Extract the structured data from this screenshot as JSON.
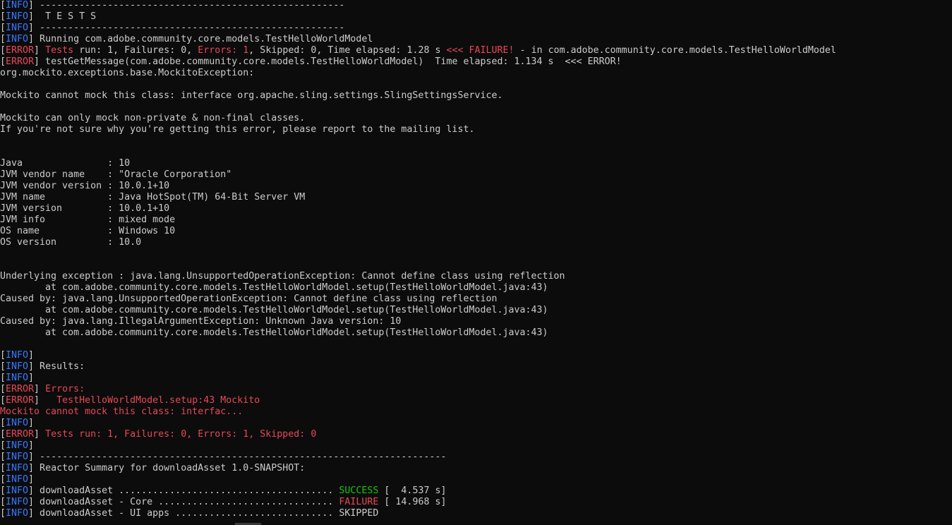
{
  "colors": {
    "background": "#0c0c0c",
    "text": "#cccccc",
    "info": "#3b78ff",
    "error": "#e74856",
    "success": "#16c60c"
  },
  "lines": [
    [
      {
        "t": "[",
        "c": "br"
      },
      {
        "t": "INFO",
        "c": "info"
      },
      {
        "t": "] ------------------------------------------------------",
        "c": "txt"
      }
    ],
    [
      {
        "t": "[",
        "c": "br"
      },
      {
        "t": "INFO",
        "c": "info"
      },
      {
        "t": "]  T E S T S",
        "c": "txt"
      }
    ],
    [
      {
        "t": "[",
        "c": "br"
      },
      {
        "t": "INFO",
        "c": "info"
      },
      {
        "t": "] ------------------------------------------------------",
        "c": "txt"
      }
    ],
    [
      {
        "t": "[",
        "c": "br"
      },
      {
        "t": "INFO",
        "c": "info"
      },
      {
        "t": "] Running com.adobe.community.core.models.TestHelloWorldModel",
        "c": "txt"
      }
    ],
    [
      {
        "t": "[",
        "c": "br"
      },
      {
        "t": "ERROR",
        "c": "err"
      },
      {
        "t": "] ",
        "c": "txt"
      },
      {
        "t": "Tests ",
        "c": "err"
      },
      {
        "t": "run: 1, Failures: 0, ",
        "c": "txt"
      },
      {
        "t": "Errors: 1",
        "c": "err"
      },
      {
        "t": ", Skipped: 0, Time elapsed: 1.28 s ",
        "c": "txt"
      },
      {
        "t": "<<< FAILURE!",
        "c": "err"
      },
      {
        "t": " - in com.adobe.community.core.models.TestHelloWorldModel",
        "c": "txt"
      }
    ],
    [
      {
        "t": "[",
        "c": "br"
      },
      {
        "t": "ERROR",
        "c": "err"
      },
      {
        "t": "] testGetMessage(com.adobe.community.core.models.TestHelloWorldModel)  Time elapsed: 1.134 s  <<< ERROR!",
        "c": "txt"
      }
    ],
    [
      {
        "t": "org.mockito.exceptions.base.MockitoException:",
        "c": "txt"
      }
    ],
    [
      {
        "t": "",
        "c": "txt"
      }
    ],
    [
      {
        "t": "Mockito cannot mock this class: interface org.apache.sling.settings.SlingSettingsService.",
        "c": "txt"
      }
    ],
    [
      {
        "t": "",
        "c": "txt"
      }
    ],
    [
      {
        "t": "Mockito can only mock non-private & non-final classes.",
        "c": "txt"
      }
    ],
    [
      {
        "t": "If you're not sure why you're getting this error, please report to the mailing list.",
        "c": "txt"
      }
    ],
    [
      {
        "t": "",
        "c": "txt"
      }
    ],
    [
      {
        "t": "",
        "c": "txt"
      }
    ],
    [
      {
        "t": "Java               : 10",
        "c": "txt"
      }
    ],
    [
      {
        "t": "JVM vendor name    : \"Oracle Corporation\"",
        "c": "txt"
      }
    ],
    [
      {
        "t": "JVM vendor version : 10.0.1+10",
        "c": "txt"
      }
    ],
    [
      {
        "t": "JVM name           : Java HotSpot(TM) 64-Bit Server VM",
        "c": "txt"
      }
    ],
    [
      {
        "t": "JVM version        : 10.0.1+10",
        "c": "txt"
      }
    ],
    [
      {
        "t": "JVM info           : mixed mode",
        "c": "txt"
      }
    ],
    [
      {
        "t": "OS name            : Windows 10",
        "c": "txt"
      }
    ],
    [
      {
        "t": "OS version         : 10.0",
        "c": "txt"
      }
    ],
    [
      {
        "t": "",
        "c": "txt"
      }
    ],
    [
      {
        "t": "",
        "c": "txt"
      }
    ],
    [
      {
        "t": "Underlying exception : java.lang.UnsupportedOperationException: Cannot define class using reflection",
        "c": "txt"
      }
    ],
    [
      {
        "t": "        at com.adobe.community.core.models.TestHelloWorldModel.setup(TestHelloWorldModel.java:43)",
        "c": "txt"
      }
    ],
    [
      {
        "t": "Caused by: java.lang.UnsupportedOperationException: Cannot define class using reflection",
        "c": "txt"
      }
    ],
    [
      {
        "t": "        at com.adobe.community.core.models.TestHelloWorldModel.setup(TestHelloWorldModel.java:43)",
        "c": "txt"
      }
    ],
    [
      {
        "t": "Caused by: java.lang.IllegalArgumentException: Unknown Java version: 10",
        "c": "txt"
      }
    ],
    [
      {
        "t": "        at com.adobe.community.core.models.TestHelloWorldModel.setup(TestHelloWorldModel.java:43)",
        "c": "txt"
      }
    ],
    [
      {
        "t": "",
        "c": "txt"
      }
    ],
    [
      {
        "t": "[",
        "c": "br"
      },
      {
        "t": "INFO",
        "c": "info"
      },
      {
        "t": "]",
        "c": "txt"
      }
    ],
    [
      {
        "t": "[",
        "c": "br"
      },
      {
        "t": "INFO",
        "c": "info"
      },
      {
        "t": "] Results:",
        "c": "txt"
      }
    ],
    [
      {
        "t": "[",
        "c": "br"
      },
      {
        "t": "INFO",
        "c": "info"
      },
      {
        "t": "]",
        "c": "txt"
      }
    ],
    [
      {
        "t": "[",
        "c": "br"
      },
      {
        "t": "ERROR",
        "c": "err"
      },
      {
        "t": "] ",
        "c": "txt"
      },
      {
        "t": "Errors:",
        "c": "err"
      }
    ],
    [
      {
        "t": "[",
        "c": "br"
      },
      {
        "t": "ERROR",
        "c": "err"
      },
      {
        "t": "]   ",
        "c": "txt"
      },
      {
        "t": "TestHelloWorldModel.setup:43 Mockito",
        "c": "err"
      }
    ],
    [
      {
        "t": "Mockito cannot mock this class: interfac...",
        "c": "err"
      }
    ],
    [
      {
        "t": "[",
        "c": "br"
      },
      {
        "t": "INFO",
        "c": "info"
      },
      {
        "t": "]",
        "c": "txt"
      }
    ],
    [
      {
        "t": "[",
        "c": "br"
      },
      {
        "t": "ERROR",
        "c": "err"
      },
      {
        "t": "] ",
        "c": "txt"
      },
      {
        "t": "Tests run: 1, Failures: 0, Errors: 1, Skipped: 0",
        "c": "err"
      }
    ],
    [
      {
        "t": "[",
        "c": "br"
      },
      {
        "t": "INFO",
        "c": "info"
      },
      {
        "t": "]",
        "c": "txt"
      }
    ],
    [
      {
        "t": "[",
        "c": "br"
      },
      {
        "t": "INFO",
        "c": "info"
      },
      {
        "t": "] ------------------------------------------------------------------------",
        "c": "txt"
      }
    ],
    [
      {
        "t": "[",
        "c": "br"
      },
      {
        "t": "INFO",
        "c": "info"
      },
      {
        "t": "] Reactor Summary for downloadAsset 1.0-SNAPSHOT:",
        "c": "txt"
      }
    ],
    [
      {
        "t": "[",
        "c": "br"
      },
      {
        "t": "INFO",
        "c": "info"
      },
      {
        "t": "]",
        "c": "txt"
      }
    ],
    [
      {
        "t": "[",
        "c": "br"
      },
      {
        "t": "INFO",
        "c": "info"
      },
      {
        "t": "] downloadAsset ...................................... ",
        "c": "txt"
      },
      {
        "t": "SUCCESS",
        "c": "ok"
      },
      {
        "t": " [  4.537 s]",
        "c": "txt"
      }
    ],
    [
      {
        "t": "[",
        "c": "br"
      },
      {
        "t": "INFO",
        "c": "info"
      },
      {
        "t": "] downloadAsset - Core ............................... ",
        "c": "txt"
      },
      {
        "t": "FAILURE",
        "c": "err"
      },
      {
        "t": " [ 14.968 s]",
        "c": "txt"
      }
    ],
    [
      {
        "t": "[",
        "c": "br"
      },
      {
        "t": "INFO",
        "c": "info"
      },
      {
        "t": "] downloadAsset - UI apps ............................ ",
        "c": "txt"
      },
      {
        "t": "SKIPPED",
        "c": "txt"
      }
    ]
  ]
}
